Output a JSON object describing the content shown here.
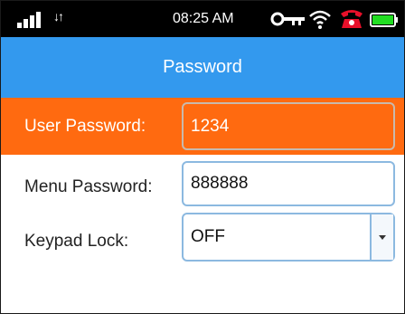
{
  "status_bar": {
    "time": "08:25 AM",
    "icons": [
      "signal-icon",
      "data-transfer-icon",
      "key-icon",
      "wifi-icon",
      "alarm-icon",
      "battery-icon"
    ],
    "battery_color": "#22dd22"
  },
  "header": {
    "title": "Password",
    "color": "#3399ee"
  },
  "form": {
    "user_password": {
      "label": "User Password:",
      "value": "1234",
      "highlight_color": "#ff6a10"
    },
    "menu_password": {
      "label": "Menu Password:",
      "value": "888888"
    },
    "keypad_lock": {
      "label": "Keypad Lock:",
      "value": "OFF"
    }
  }
}
